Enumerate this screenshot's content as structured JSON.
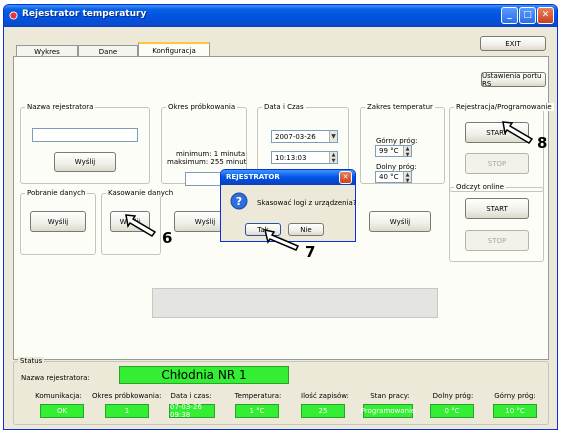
{
  "window": {
    "title": "Rejestrator temperatury",
    "minimize": "_",
    "maximize": "□",
    "close": "✕"
  },
  "tabs": [
    {
      "label": "Wykres"
    },
    {
      "label": "Dane"
    },
    {
      "label": "Konfiguracja"
    }
  ],
  "toolbar": {
    "exit_label": "EXIT",
    "port_settings_label": "Ustawienia portu RS"
  },
  "groups": {
    "name": {
      "title": "Nazwa rejestratora",
      "value": "",
      "send": "Wyślij"
    },
    "period": {
      "title": "Okres próbkowania",
      "min_text": "minimum: 1 minuta",
      "max_text": "maksimum: 255 minut",
      "value": "",
      "send": "Wyślij"
    },
    "datetime": {
      "title": "Data i Czas",
      "date": "2007-03-26",
      "time": "10:13:03"
    },
    "temp_range": {
      "title": "Zakres temperatur",
      "upper_label": "Górny próg:",
      "upper_value": "99 °C",
      "lower_label": "Dolny próg:",
      "lower_value": "40 °C",
      "send": "Wyślij"
    },
    "download": {
      "title": "Pobranie danych",
      "send": "Wyślij"
    },
    "delete": {
      "title": "Kasowanie danych",
      "send": "Wyślij"
    },
    "registration": {
      "title": "Rejestracja/Programowanie",
      "start": "START",
      "stop": "STOP"
    },
    "online": {
      "title": "Odczyt online",
      "start": "START",
      "stop": "STOP"
    }
  },
  "dialog": {
    "title": "REJESTRATOR",
    "message": "Skasować logi z urządzenia?",
    "yes": "Tak",
    "no": "Nie"
  },
  "status": {
    "title": "Status",
    "name_label": "Nazwa rejestratora:",
    "name_value": "Chłodnia NR 1",
    "headers": [
      "Komunikacja:",
      "Okres próbkowania:",
      "Data i czas:",
      "Temperatura:",
      "Ilość zapisów:",
      "Stan pracy:",
      "Dolny próg:",
      "Górny próg:"
    ],
    "values": [
      "OK",
      "1",
      "07-03-26 09:38",
      "1 °C",
      "25",
      "Programowanie",
      "0 °C",
      "10 °C"
    ]
  },
  "callouts": {
    "six": "6",
    "seven": "7",
    "eight": "8"
  }
}
